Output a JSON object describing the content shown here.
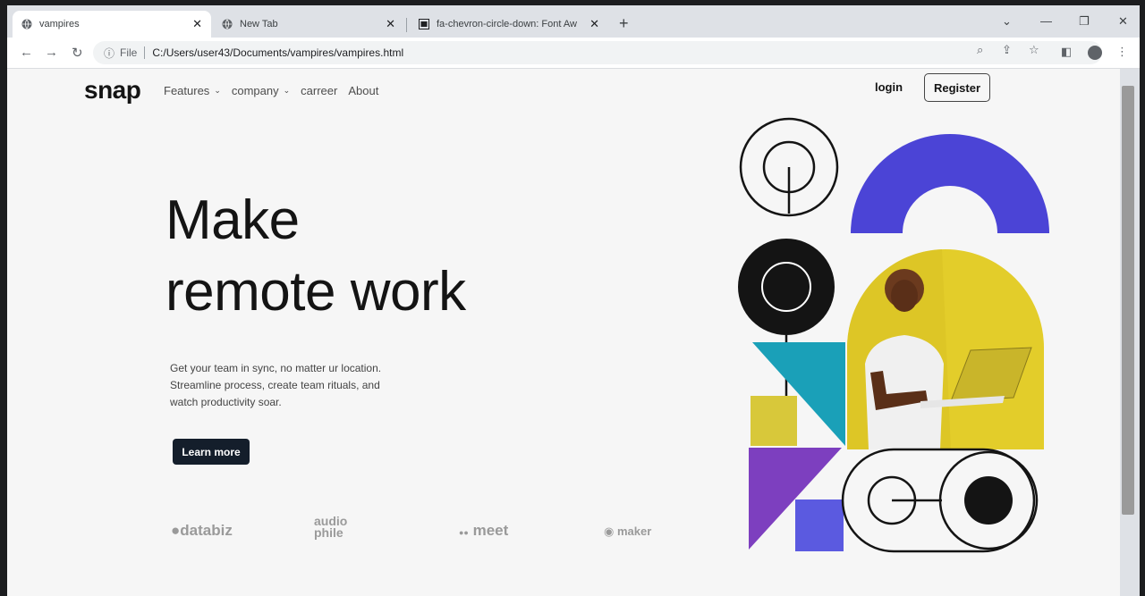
{
  "browser": {
    "tabs": [
      {
        "title": "vampires"
      },
      {
        "title": "New Tab"
      },
      {
        "title": "fa-chevron-circle-down: Font Aw"
      }
    ],
    "address": {
      "scheme": "File",
      "url": "C:/Users/user43/Documents/vampires/vampires.html"
    }
  },
  "header": {
    "brand": "snap",
    "nav": [
      {
        "label": "Features"
      },
      {
        "label": "company"
      },
      {
        "label": "carreer"
      },
      {
        "label": "About"
      }
    ],
    "login": "login",
    "register": "Register"
  },
  "hero": {
    "title_line1": "Make",
    "title_line2": "remote work",
    "subtitle_line1": "Get your team in sync, no matter ur location.",
    "subtitle_line2": "Streamline process, create team rituals, and",
    "subtitle_line3": "watch productivity soar.",
    "cta": "Learn more"
  },
  "clients": [
    {
      "name": "databiz"
    },
    {
      "name": "audio phile"
    },
    {
      "name": "meet"
    },
    {
      "name": "maker"
    }
  ],
  "colors": {
    "accent_blue": "#4b44d6",
    "accent_yellow": "#e3cd2a",
    "teal": "#1aa0b8",
    "purple": "#7d3fbf",
    "dark": "#141e2b"
  }
}
